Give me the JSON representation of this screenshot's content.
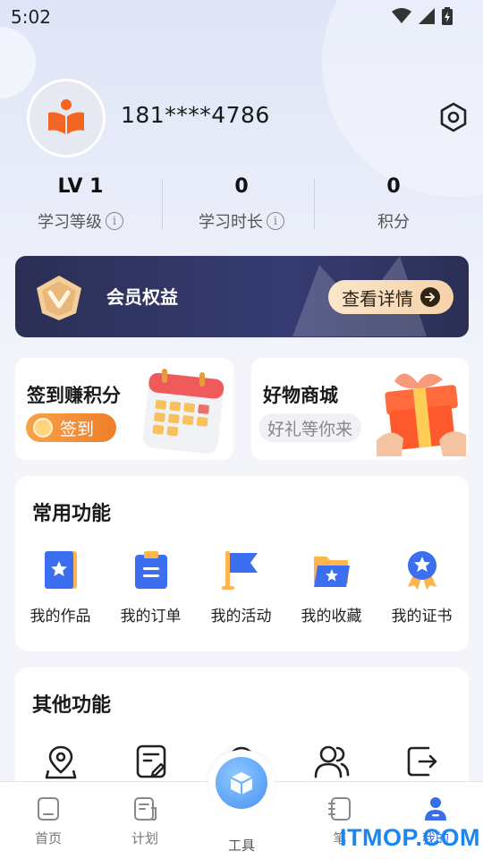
{
  "status_bar": {
    "time": "5:02"
  },
  "profile": {
    "username": "181****4786"
  },
  "stats": [
    {
      "value": "LV 1",
      "label": "学习等级",
      "info": "i"
    },
    {
      "value": "0",
      "label": "学习时长",
      "info": "i"
    },
    {
      "value": "0",
      "label": "积分"
    }
  ],
  "member": {
    "title": "会员权益",
    "detail_label": "查看详情"
  },
  "cards": {
    "sign": {
      "title": "签到赚积分",
      "button": "签到"
    },
    "shop": {
      "title": "好物商城",
      "subtitle": "好礼等你来"
    }
  },
  "common": {
    "title": "常用功能",
    "items": [
      {
        "label": "我的作品",
        "icon": "book-star-icon"
      },
      {
        "label": "我的订单",
        "icon": "clipboard-icon"
      },
      {
        "label": "我的活动",
        "icon": "flag-icon"
      },
      {
        "label": "我的收藏",
        "icon": "folder-star-icon"
      },
      {
        "label": "我的证书",
        "icon": "medal-icon"
      }
    ]
  },
  "other": {
    "title": "其他功能",
    "items": [
      {
        "icon": "location-pin-icon"
      },
      {
        "icon": "edit-document-icon"
      },
      {
        "icon": "headset-icon"
      },
      {
        "icon": "users-icon"
      },
      {
        "icon": "logout-icon"
      }
    ]
  },
  "nav": {
    "items": [
      {
        "label": "首页"
      },
      {
        "label": "计划"
      },
      {
        "label": "工具"
      },
      {
        "label": "笔"
      },
      {
        "label": "我的"
      }
    ]
  },
  "watermark": "ITMOP.COM",
  "colors": {
    "accent": "#3a6ee8",
    "member_bg": "#2b2f55",
    "orange": "#f07e2a"
  }
}
